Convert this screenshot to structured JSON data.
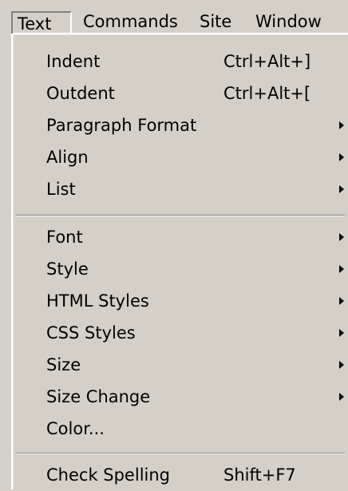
{
  "menubar": {
    "items": [
      {
        "label": "Text"
      },
      {
        "label": "Commands"
      },
      {
        "label": "Site"
      },
      {
        "label": "Window"
      }
    ],
    "selected": "Text"
  },
  "text_menu": {
    "groups": [
      {
        "items": [
          {
            "label": "Indent",
            "shortcut": "Ctrl+Alt+]"
          },
          {
            "label": "Outdent",
            "shortcut": "Ctrl+Alt+["
          },
          {
            "label": "Paragraph Format",
            "submenu": true
          },
          {
            "label": "Align",
            "submenu": true
          },
          {
            "label": "List",
            "submenu": true
          }
        ]
      },
      {
        "items": [
          {
            "label": "Font",
            "submenu": true
          },
          {
            "label": "Style",
            "submenu": true
          },
          {
            "label": "HTML Styles",
            "submenu": true
          },
          {
            "label": "CSS Styles",
            "submenu": true
          },
          {
            "label": "Size",
            "submenu": true
          },
          {
            "label": "Size Change",
            "submenu": true
          },
          {
            "label": "Color..."
          }
        ]
      },
      {
        "items": [
          {
            "label": "Check Spelling",
            "shortcut": "Shift+F7"
          }
        ]
      }
    ]
  }
}
